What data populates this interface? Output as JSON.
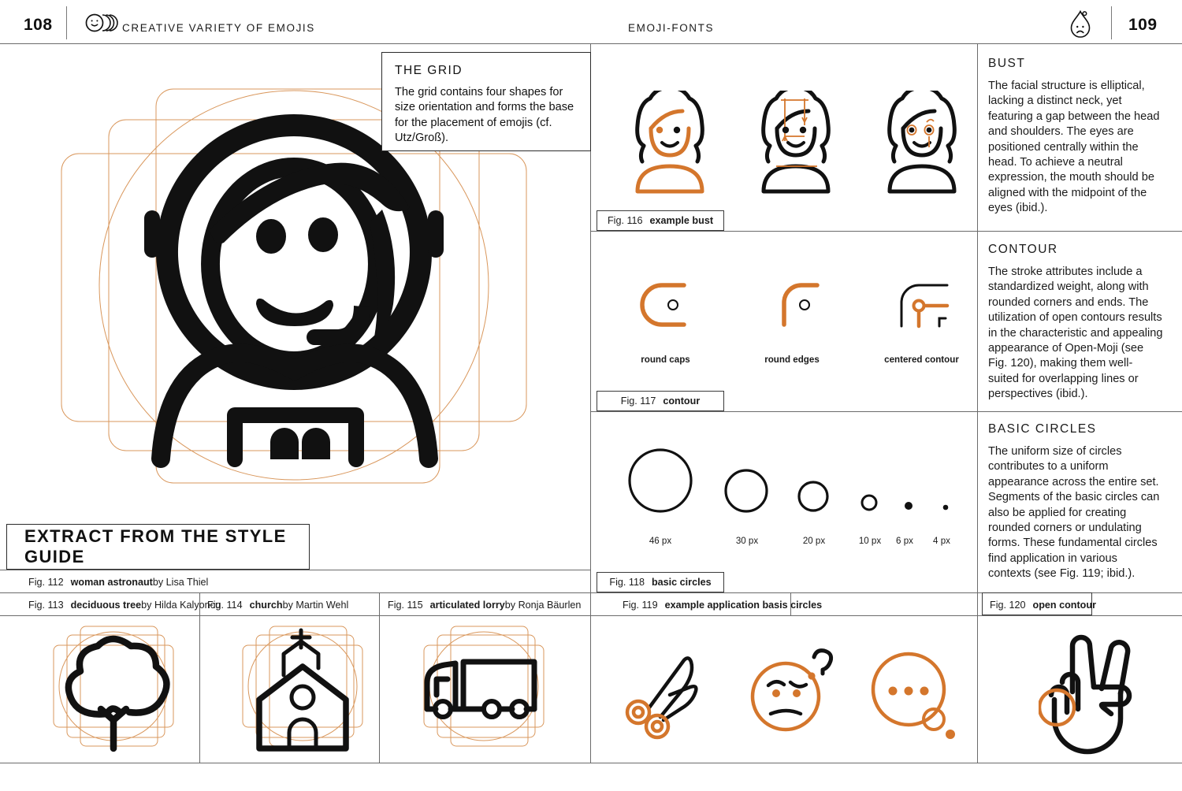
{
  "header": {
    "left_page_number": "108",
    "left_title": "CREATIVE VARIETY OF EMOJIS",
    "right_title": "EMOJI-FONTS",
    "right_page_number": "109",
    "left_icon": "stacked-smiley-icon",
    "right_icon": "sad-drop-face-icon"
  },
  "callouts": {
    "the_grid": {
      "heading": "THE GRID",
      "body": "The grid contains four shapes for size orientation and forms the base for the placement of emojis (cf. Utz/Groß)."
    }
  },
  "style_guide_banner": {
    "label": "EXTRACT FROM THE STYLE GUIDE"
  },
  "panels": [
    {
      "id": "bust",
      "heading": "BUST",
      "body": "The facial structure is elliptical, lacking a distinct neck, yet featuring a gap between the head and shoulders. The eyes are positioned centrally within the head. To achieve a neutral expression, the mouth should be aligned with the midpoint of the eyes (ibid.)."
    },
    {
      "id": "contour",
      "heading": "CONTOUR",
      "body": "The stroke attributes include a standardized weight, along with rounded corners and ends. The utilization of open contours results in the characteristic and appealing appearance of Open-Moji (see Fig. 120), making them well-suited for overlapping lines or perspectives (ibid.)."
    },
    {
      "id": "basic_circles",
      "heading": "BASIC CIRCLES",
      "body": "The uniform size of circles contributes to a uniform appearance across the entire set. Segments of the basic circles can also be applied for creating rounded corners or undulating forms. These fundamental circles find application in various contexts (see Fig. 119; ibid.)."
    }
  ],
  "figures": [
    {
      "id": "fig112",
      "number": "Fig. 112",
      "title": "woman astronaut",
      "by": " by Lisa Thiel"
    },
    {
      "id": "fig113",
      "number": "Fig. 113",
      "title": "deciduous tree",
      "by": " by Hilda Kalyoncu"
    },
    {
      "id": "fig114",
      "number": "Fig. 114",
      "title": "church",
      "by": " by Martin Wehl"
    },
    {
      "id": "fig115",
      "number": "Fig. 115",
      "title": "articulated lorry",
      "by": " by Ronja Bäurlen"
    },
    {
      "id": "fig116",
      "number": "Fig. 116",
      "title": "example bust",
      "by": ""
    },
    {
      "id": "fig117",
      "number": "Fig. 117",
      "title": "contour",
      "by": ""
    },
    {
      "id": "fig118",
      "number": "Fig. 118",
      "title": "basic circles",
      "by": ""
    },
    {
      "id": "fig119",
      "number": "Fig. 119",
      "title": "example application basis circles",
      "by": ""
    },
    {
      "id": "fig120",
      "number": "Fig. 120",
      "title": "open contour",
      "by": ""
    }
  ],
  "contour_labels": [
    "round caps",
    "round edges",
    "centered contour"
  ],
  "circle_labels": [
    "46 px",
    "30 px",
    "20 px",
    "10 px",
    "6 px",
    "4 px"
  ],
  "colors": {
    "accent_orange": "#D4762C",
    "grid_orange": "#D9975C",
    "ink_black": "#111111",
    "rule_grey": "#6b6b6b"
  }
}
